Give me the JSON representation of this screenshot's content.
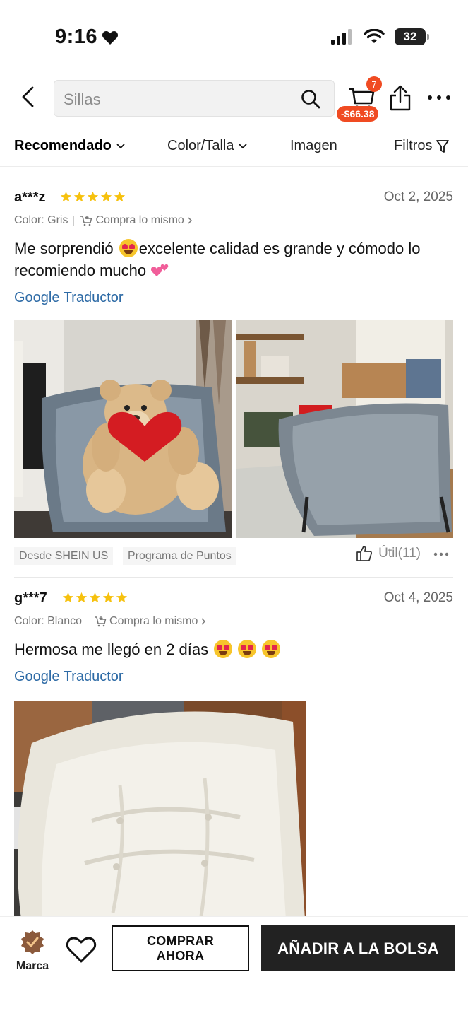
{
  "status_bar": {
    "time": "9:16",
    "battery": "32"
  },
  "header": {
    "search_placeholder": "Sillas",
    "cart_count": "7",
    "cart_discount": "-$66.38"
  },
  "sort_bar": {
    "items": [
      {
        "label": "Recomendado",
        "active": true
      },
      {
        "label": "Color/Talla",
        "active": false
      },
      {
        "label": "Imagen",
        "active": false
      },
      {
        "label": "Filtros",
        "active": false
      }
    ]
  },
  "reviews": [
    {
      "user": "a***z",
      "rating": 5,
      "date": "Oct 2, 2025",
      "color": "Color: Gris",
      "buy_same": "Compra lo mismo",
      "text_part1": "Me sorprendió ",
      "text_part2": "excelente calidad es grande y cómodo lo recomiendo mucho ",
      "translate": "Google Traductor",
      "tags": [
        "Desde SHEIN US",
        "Programa de Puntos"
      ],
      "useful": "Útil(11)"
    },
    {
      "user": "g***7",
      "rating": 5,
      "date": "Oct 4, 2025",
      "color": "Color: Blanco",
      "buy_same": "Compra lo mismo",
      "text_part1": "Hermosa me llegó en 2 días ",
      "translate": "Google Traductor"
    }
  ],
  "bottom_bar": {
    "brand_label": "Marca",
    "buy_now": "COMPRAR AHORA",
    "add_to_bag": "AÑADIR A LA BOLSA"
  },
  "colors": {
    "accent_red": "#f04b22",
    "star_yellow": "#f6c10e",
    "link_blue": "#2e6ba6",
    "button_dark": "#222222"
  },
  "icons": [
    "heart-icon",
    "signal-icon",
    "wifi-icon",
    "battery-icon",
    "back-arrow-icon",
    "search-icon",
    "cart-icon",
    "share-icon",
    "more-icon",
    "chevron-down-icon",
    "filter-icon",
    "star-icon",
    "cart-plus-icon",
    "chevron-right-icon",
    "thumbs-up-icon",
    "brand-badge-icon",
    "wishlist-heart-icon"
  ]
}
